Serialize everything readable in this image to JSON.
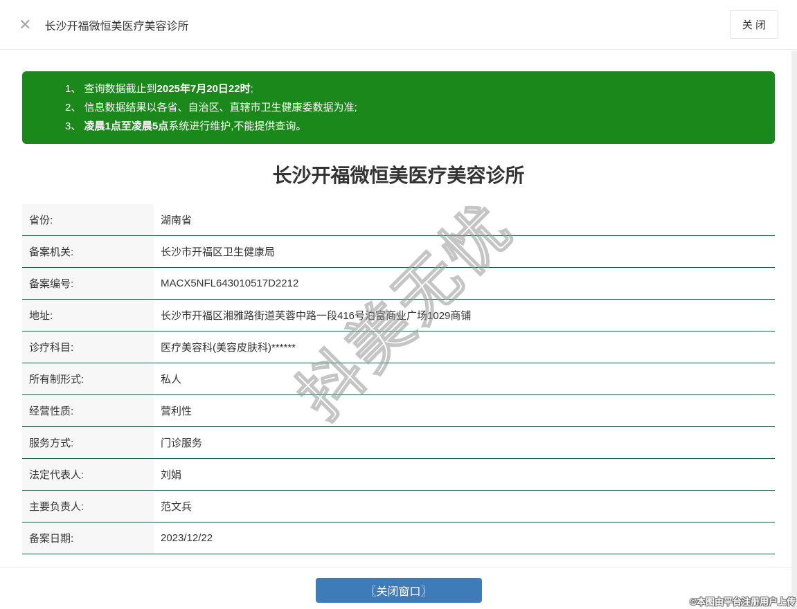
{
  "header": {
    "close_icon": "✕",
    "title": "长沙开福微恒美医疗美容诊所",
    "close_button_label": "关 闭"
  },
  "notice": {
    "line1_prefix": "1、 查询数据截止到",
    "line1_bold": "2025年7月20日22时",
    "line1_suffix": ";",
    "line2": "2、 信息数据结果以各省、自治区、直辖市卫生健康委数据为准;",
    "line3_prefix": "3、 ",
    "line3_bold": "凌晨1点至凌晨5点",
    "line3_suffix": "系统进行维护,不能提供查询。"
  },
  "main": {
    "title": "长沙开福微恒美医疗美容诊所"
  },
  "table": {
    "rows": [
      {
        "label": "省份:",
        "value": "湖南省"
      },
      {
        "label": "备案机关:",
        "value": "长沙市开福区卫生健康局"
      },
      {
        "label": "备案编号:",
        "value": "MACX5NFL643010517D2212"
      },
      {
        "label": "地址:",
        "value": "长沙市开福区湘雅路街道芙蓉中路一段416号泊富商业广场1029商铺"
      },
      {
        "label": "诊疗科目:",
        "value": "医疗美容科(美容皮肤科)******"
      },
      {
        "label": "所有制形式:",
        "value": "私人"
      },
      {
        "label": "经营性质:",
        "value": "营利性"
      },
      {
        "label": "服务方式:",
        "value": "门诊服务"
      },
      {
        "label": "法定代表人:",
        "value": "刘娟"
      },
      {
        "label": "主要负责人:",
        "value": "范文兵"
      },
      {
        "label": "备案日期:",
        "value": "2023/12/22"
      }
    ]
  },
  "footer": {
    "close_window_button_label": "〖关闭窗口〗"
  },
  "watermark": {
    "text": "抖美无忧"
  },
  "credit": {
    "text": "©本图由平台注册用户上传"
  },
  "colors": {
    "notice_green": "#1b881b",
    "row_border_teal": "#28584a",
    "button_blue": "#3d7cb8"
  }
}
